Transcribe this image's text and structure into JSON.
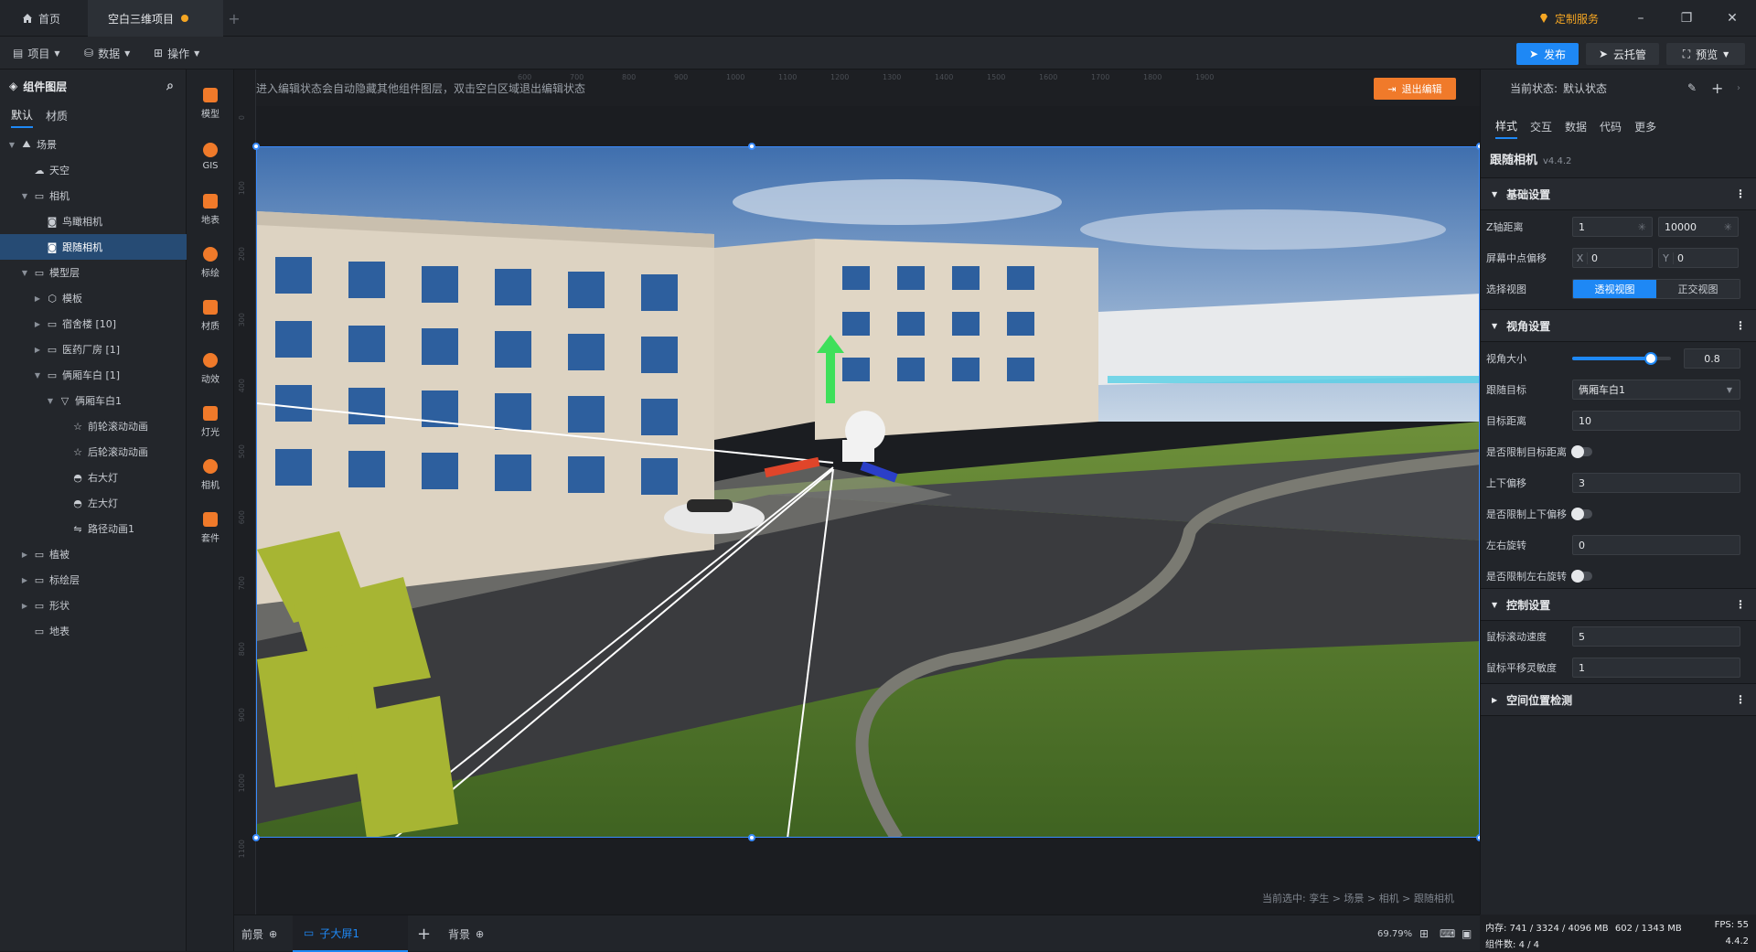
{
  "titlebar": {
    "home_tab": "首页",
    "project_tab": "空白三维项目",
    "custom_service": "定制服务"
  },
  "toolbar": {
    "menu_project": "项目",
    "menu_data": "数据",
    "menu_operation": "操作",
    "publish": "发布",
    "cloud_hosting": "云托管",
    "preview": "预览"
  },
  "left_panel": {
    "title": "组件图层",
    "tabs": [
      "默认",
      "材质"
    ],
    "tree": [
      {
        "label": "场景",
        "depth": 0,
        "arrow": "down",
        "icon": "scene-icon"
      },
      {
        "label": "天空",
        "depth": 1,
        "arrow": "",
        "icon": "sky-icon"
      },
      {
        "label": "相机",
        "depth": 1,
        "arrow": "down",
        "icon": "folder-icon"
      },
      {
        "label": "鸟瞰相机",
        "depth": 2,
        "arrow": "",
        "icon": "camera-icon"
      },
      {
        "label": "跟随相机",
        "depth": 2,
        "arrow": "",
        "icon": "camera-icon",
        "selected": true
      },
      {
        "label": "模型层",
        "depth": 1,
        "arrow": "down",
        "icon": "folder-icon"
      },
      {
        "label": "模板",
        "depth": 2,
        "arrow": "right",
        "icon": "cube-icon"
      },
      {
        "label": "宿舍楼 [10]",
        "depth": 2,
        "arrow": "right",
        "icon": "folder-icon"
      },
      {
        "label": "医药厂房 [1]",
        "depth": 2,
        "arrow": "right",
        "icon": "folder-icon"
      },
      {
        "label": "俩厢车白 [1]",
        "depth": 2,
        "arrow": "down",
        "icon": "folder-icon"
      },
      {
        "label": "俩厢车白1",
        "depth": 3,
        "arrow": "down",
        "icon": "model-icon"
      },
      {
        "label": "前轮滚动动画",
        "depth": 4,
        "arrow": "",
        "icon": "star-icon"
      },
      {
        "label": "后轮滚动动画",
        "depth": 4,
        "arrow": "",
        "icon": "star-icon"
      },
      {
        "label": "右大灯",
        "depth": 4,
        "arrow": "",
        "icon": "light-icon"
      },
      {
        "label": "左大灯",
        "depth": 4,
        "arrow": "",
        "icon": "light-icon"
      },
      {
        "label": "路径动画1",
        "depth": 4,
        "arrow": "",
        "icon": "path-icon"
      },
      {
        "label": "植被",
        "depth": 1,
        "arrow": "right",
        "icon": "folder-icon"
      },
      {
        "label": "标绘层",
        "depth": 1,
        "arrow": "right",
        "icon": "folder-icon"
      },
      {
        "label": "形状",
        "depth": 1,
        "arrow": "right",
        "icon": "folder-icon"
      },
      {
        "label": "地表",
        "depth": 1,
        "arrow": "",
        "icon": "folder-icon"
      }
    ]
  },
  "icon_bar": [
    "模型",
    "GIS",
    "地表",
    "标绘",
    "材质",
    "动效",
    "灯光",
    "相机",
    "套件"
  ],
  "canvas": {
    "hint": "进入编辑状态会自动隐藏其他组件图层，双击空白区域退出编辑状态",
    "exit_edit": "退出编辑",
    "selection_path": "当前选中: 孪生 > 场景 > 相机 > 跟随相机",
    "ruler_top": [
      "600",
      "700",
      "800",
      "900",
      "1000",
      "1100",
      "1200",
      "1300",
      "1400",
      "1500",
      "1600",
      "1700",
      "1800",
      "1900"
    ],
    "ruler_left": [
      "0",
      "100",
      "200",
      "300",
      "400",
      "500",
      "600",
      "700",
      "800",
      "900",
      "1000",
      "1100"
    ]
  },
  "bottom_bar": {
    "foreground": "前景",
    "screen_tab": "子大屏1",
    "background": "背景",
    "zoom": "69.79%"
  },
  "right_panel": {
    "state_label": "当前状态:",
    "state_value": "默认状态",
    "tabs": [
      "样式",
      "交互",
      "数据",
      "代码",
      "更多"
    ],
    "component_name": "跟随相机",
    "component_version": "v4.4.2",
    "sections": {
      "basic": "基础设置",
      "view": "视角设置",
      "control": "控制设置",
      "space": "空间位置检测"
    },
    "props": {
      "z_distance_label": "Z轴距离",
      "z_near": "1",
      "z_far": "10000",
      "center_offset_label": "屏幕中点偏移",
      "x_label": "X",
      "x_value": "0",
      "y_label": "Y",
      "y_value": "0",
      "view_label": "选择视图",
      "perspective": "透视视图",
      "orthographic": "正交视图",
      "fov_label": "视角大小",
      "fov_value": "0.8",
      "fov_slider_fraction": 0.8,
      "target_label": "跟随目标",
      "target_value": "俩厢车白1",
      "distance_label": "目标距离",
      "distance_value": "10",
      "limit_distance_label": "是否限制目标距离",
      "vertical_label": "上下偏移",
      "vertical_value": "3",
      "limit_vertical_label": "是否限制上下偏移",
      "rotate_label": "左右旋转",
      "rotate_value": "0",
      "limit_rotate_label": "是否限制左右旋转",
      "wheel_speed_label": "鼠标滚动速度",
      "wheel_speed_value": "5",
      "pan_sens_label": "鼠标平移灵敏度",
      "pan_sens_value": "1"
    }
  },
  "status_bar": {
    "memory_label": "内存:",
    "memory_value": "741 / 3324 / 4096 MB",
    "gpu_value": "602 / 1343 MB",
    "fps_label": "FPS:",
    "fps_value": "55",
    "components_label": "组件数:",
    "components_value": "4 / 4",
    "version": "4.4.2"
  },
  "colors": {
    "accent": "#1e88f5",
    "orange": "#f07a2a",
    "selected_row": "#264b74"
  }
}
